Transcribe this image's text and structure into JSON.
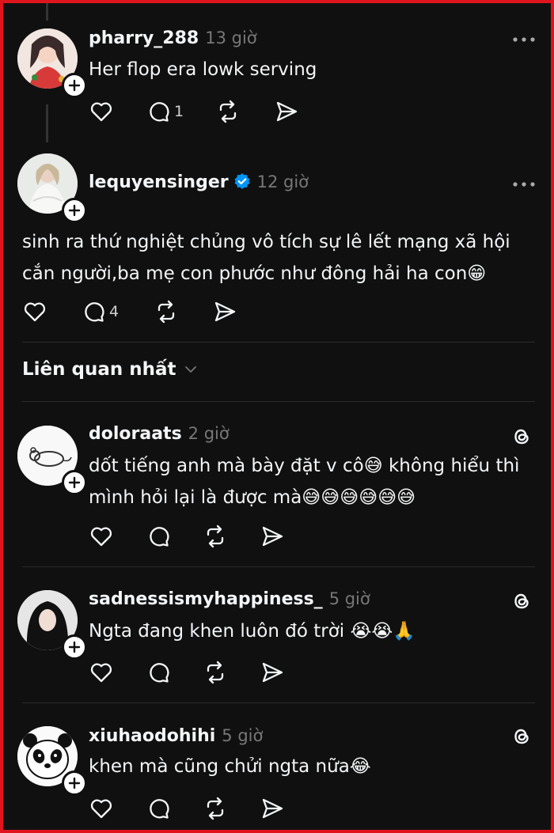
{
  "posts": [
    {
      "username": "pharry_288",
      "time": "13 giờ",
      "text": "Her flop era lowk serving",
      "replies": "1",
      "menu_icon": "more-dots-icon"
    },
    {
      "username": "lequyensinger",
      "time": "12 giờ",
      "text_line1": "sinh ra thứ nghiệt chủng vô tích sự lê lết mạng xã hội",
      "text_line2": "cắn người,ba mẹ con phước như đông hải ha con😁",
      "replies": "4",
      "verified": true,
      "menu_icon": "more-dots-icon"
    }
  ],
  "sort": {
    "label": "Liên quan nhất"
  },
  "comments": [
    {
      "username": "doloraats",
      "time": "2 giờ",
      "text_line1": "dốt tiếng anh mà bày đặt v cô😅 không hiểu thì",
      "text_line2": "mình hỏi lại là được mà😅😅😅😅😅😅"
    },
    {
      "username": "sadnessismyhappiness_",
      "time": "5 giờ",
      "text": "Ngta đang khen luôn đó trời 😭😭🙏"
    },
    {
      "username": "xiuhaodohihi",
      "time": "5 giờ",
      "text": "khen mà cũng chửi ngta nữa😂"
    }
  ],
  "colors": {
    "background": "#101010",
    "border": "#e0141c",
    "verified": "#0095f6",
    "muted": "#777777"
  }
}
